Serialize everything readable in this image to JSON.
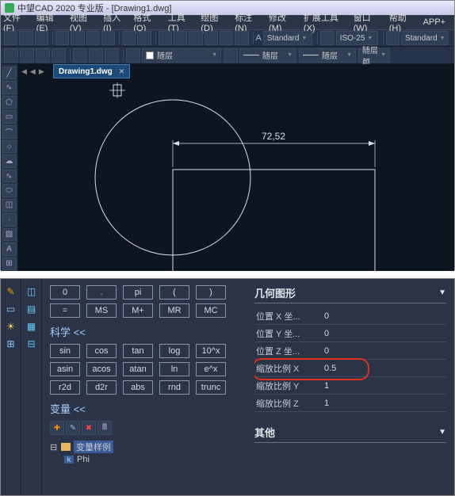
{
  "title": "中望CAD 2020 专业版 - [Drawing1.dwg]",
  "menus": [
    "文件(F)",
    "编辑(E)",
    "视图(V)",
    "插入(I)",
    "格式(O)",
    "工具(T)",
    "绘图(D)",
    "标注(N)",
    "修改(M)",
    "扩展工具(X)",
    "窗口(W)",
    "帮助(H)",
    "APP+"
  ],
  "styles": {
    "text_style": "Standard",
    "dim_style": "ISO-25",
    "table_style": "Standard"
  },
  "layers": {
    "l1": "随层",
    "l2": "随层",
    "l3": "随层",
    "l4": "随层颜"
  },
  "doc_tab": {
    "label": "Drawing1.dwg",
    "close": "✕"
  },
  "dimension_value": "72,52",
  "calc": {
    "row1": [
      "0",
      ".",
      "pi",
      "(",
      ")"
    ],
    "row2": [
      "=",
      "MS",
      "M+",
      "MR",
      "MC"
    ],
    "sci_title": "科学",
    "sci1": [
      "sin",
      "cos",
      "tan",
      "log",
      "10^x"
    ],
    "sci2": [
      "asin",
      "acos",
      "atan",
      "ln",
      "e^x"
    ],
    "sci3": [
      "r2d",
      "d2r",
      "abs",
      "rnd",
      "trunc"
    ],
    "var_title": "变量",
    "var_root": "变量样例",
    "var_phi": "Phi"
  },
  "props": {
    "geom_title": "几何图形",
    "rows": [
      {
        "label": "位置 X 坐...",
        "value": "0"
      },
      {
        "label": "位置 Y 坐...",
        "value": "0"
      },
      {
        "label": "位置 Z 坐...",
        "value": "0"
      },
      {
        "label": "缩放比例 X",
        "value": "0.5"
      },
      {
        "label": "缩放比例 Y",
        "value": "1"
      },
      {
        "label": "缩放比例 Z",
        "value": "1"
      }
    ],
    "other_title": "其他"
  }
}
